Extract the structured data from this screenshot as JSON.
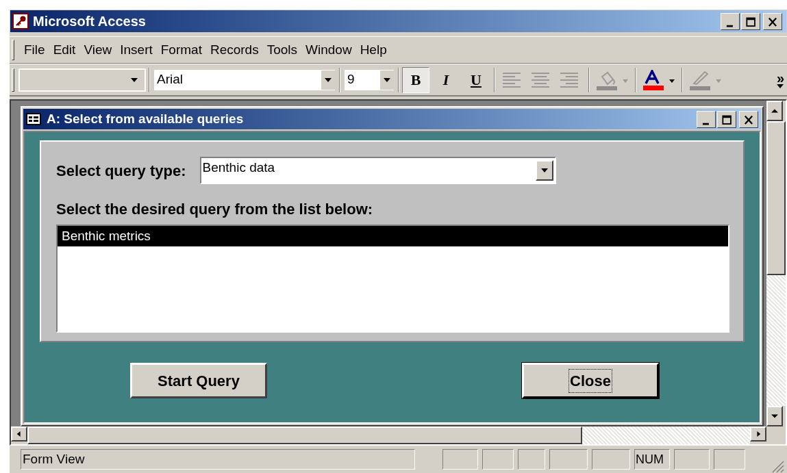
{
  "window": {
    "title": "Microsoft Access"
  },
  "menu": [
    "File",
    "Edit",
    "View",
    "Insert",
    "Format",
    "Records",
    "Tools",
    "Window",
    "Help"
  ],
  "toolbar": {
    "font_combo": {
      "value": "Arial"
    },
    "size_combo": {
      "value": "9"
    },
    "format_buttons": [
      {
        "label": "B",
        "kind": "bold",
        "selected": true
      },
      {
        "label": "I",
        "kind": "italic",
        "selected": false
      },
      {
        "label": "U",
        "kind": "underline",
        "selected": false
      }
    ],
    "overflow": "»"
  },
  "form": {
    "title": "A: Select from available queries",
    "query_type_label": "Select query type:",
    "query_type": {
      "value": "Benthic data"
    },
    "list_label": "Select the desired query from the list below:",
    "queries": [
      {
        "label": "Benthic metrics",
        "selected": true
      }
    ],
    "buttons": [
      {
        "label": "Start Query",
        "focused": false
      },
      {
        "label": "Close",
        "focused": true
      }
    ]
  },
  "status_bar": {
    "text": "Form View",
    "num_indicator": "NUM"
  }
}
